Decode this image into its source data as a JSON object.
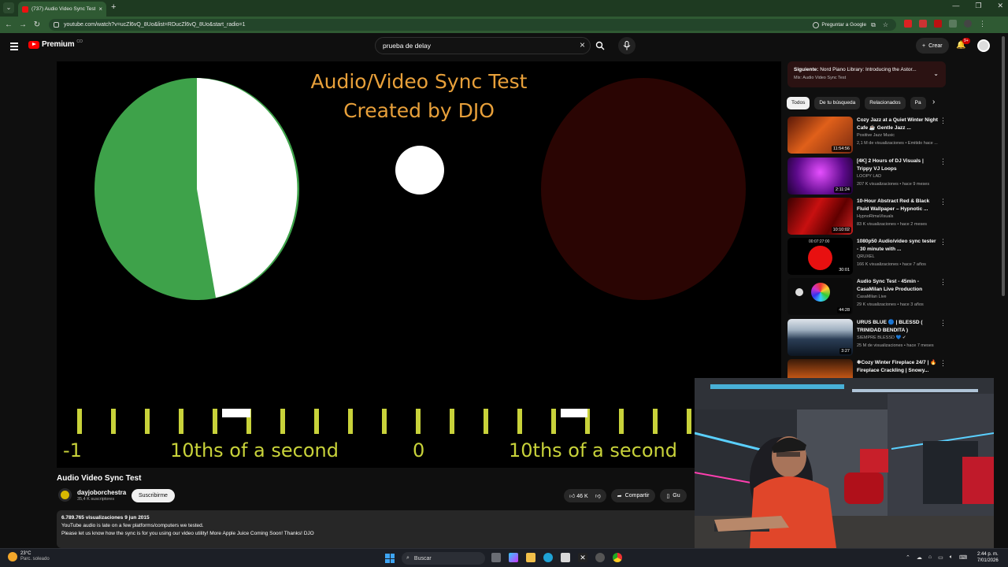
{
  "browser": {
    "tab_title": "(737) Audio Video Sync Test - Y",
    "url": "youtube.com/watch?v=ucZl6vQ_8Uo&list=RDucZl6vQ_8Uo&start_radio=1",
    "ask_google": "Preguntar a Google"
  },
  "header": {
    "logo_text": "Premium",
    "logo_sup": "CO",
    "search_value": "prueba de delay",
    "create_label": "Crear",
    "notification_count": "9+"
  },
  "video": {
    "title_line1": "Audio/Video Sync Test",
    "title_line2": "Created by DJO",
    "scale_labels": [
      "-1",
      "10ths of a second",
      "0",
      "10ths of a second"
    ],
    "colors": {
      "green": "#3ea24a",
      "yellow": "#c8d23a",
      "dark_red": "#2a0503",
      "orange": "#e8a03a"
    }
  },
  "info": {
    "title": "Audio Video Sync Test",
    "channel": "dayjoborchestra",
    "subscribers": "35,4 K suscriptores",
    "subscribe_label": "Suscribirme",
    "likes": "46 K",
    "share_label": "Compartir",
    "save_label": "Gu",
    "views_date": "6.789.765 visualizaciones  9 jun 2015",
    "desc_line1": "YouTube audio is late on a few platforms/computers we tested.",
    "desc_line2": "Please let us know how the sync is for you using our video utility! More Apple Juice Coming Soon! Thanks!  DJO"
  },
  "sidebar": {
    "next_label": "Siguiente:",
    "next_title": "Nord Piano Library: Introducing the Astor...",
    "next_mix": "Mix: Audio Video Sync Test",
    "chips": [
      "Todos",
      "De tu búsqueda",
      "Relacionados",
      "Pa"
    ],
    "recs": [
      {
        "title": "Cozy Jazz at a Quiet Winter Night Cafe ☕ Gentle Jazz ...",
        "channel": "Positive Jazz Music",
        "meta": "2,1 M de visualizaciones • Emitido hace ...",
        "duration": "11:54:56"
      },
      {
        "title": "[4K] 2 Hours of DJ Visuals | Trippy VJ Loops",
        "channel": "LOOPY LAD",
        "meta": "207 K visualizaciones • hace 9 meses",
        "duration": "2:11:24"
      },
      {
        "title": "10-Hour Abstract Red & Black Fluid Wallpaper – Hypnotic ...",
        "channel": "HypnoRimaVisuals",
        "meta": "83 K visualizaciones • hace 2 meses",
        "duration": "10:10:02"
      },
      {
        "title": "1080p50 Audio/video sync tester - 30 minute with ...",
        "channel": "QRUXEL",
        "meta": "166 K visualizaciones • hace 7 años",
        "duration": "30:01"
      },
      {
        "title": "Audio Sync Test - 45min - CasaMilan Live Production",
        "channel": "CasaMilan Live",
        "meta": "29 K visualizaciones • hace 3 años",
        "duration": "44:28"
      },
      {
        "title": "URUS BLUE 🔵 | BLESSD ( TRINIDAD BENDITA )",
        "channel": "SIEMPRE BLESSD 💙 ✔",
        "meta": "25 M de visualizaciones • hace 7 meses",
        "duration": "3:27"
      },
      {
        "title": "❄Cozy Winter Fireplace 24/7 | 🔥Fireplace Crackling | Snowy...",
        "channel": "",
        "meta": "",
        "duration": ""
      }
    ],
    "rec3_time": "00:07:27:00"
  },
  "taskbar": {
    "temp": "23°C",
    "weather": "Parc. soleado",
    "search_placeholder": "Buscar",
    "time": "2:44 p. m.",
    "date": "7/01/2026"
  }
}
